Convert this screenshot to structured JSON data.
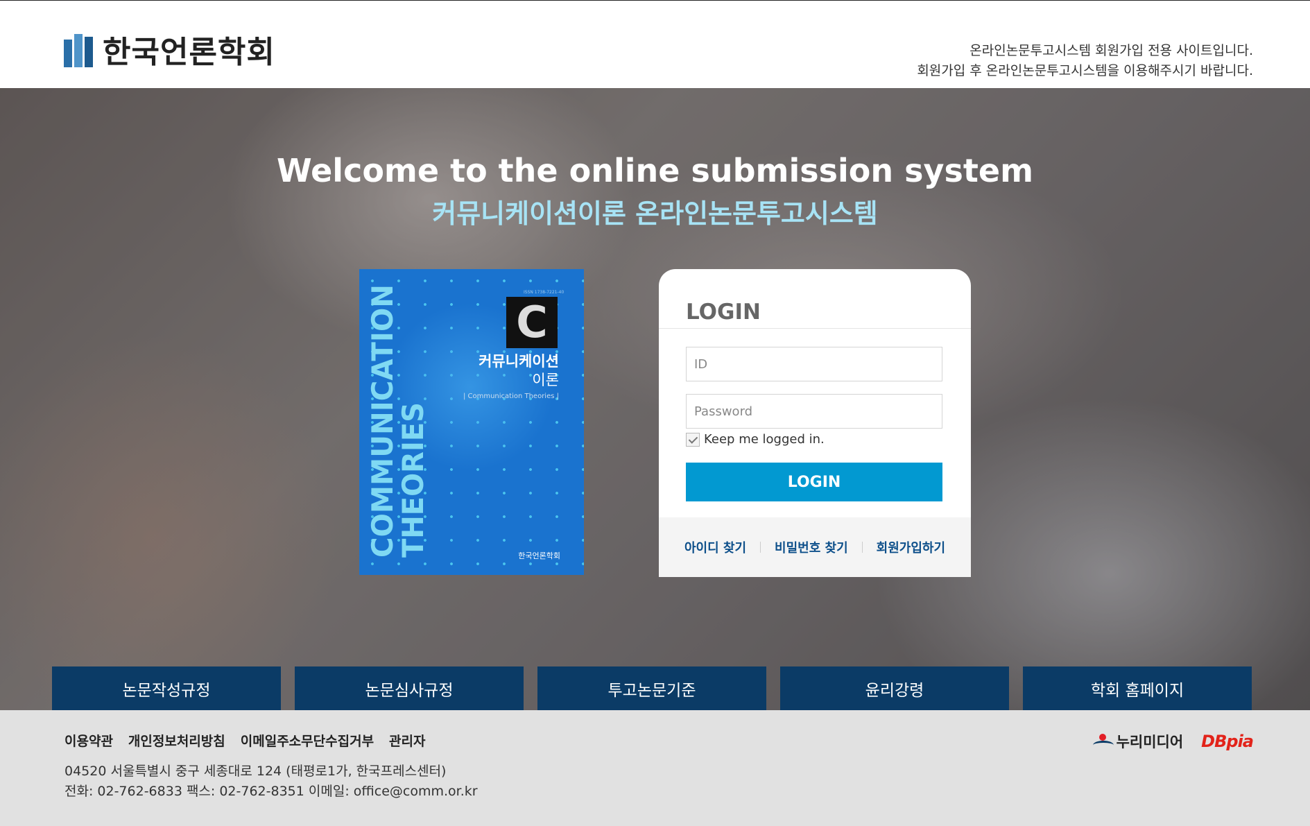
{
  "header": {
    "logo_text": "한국언론학회",
    "notice_line1": "온라인논문투고시스템 회원가입 전용 사이트입니다.",
    "notice_line2": "회원가입 후 온라인논문투고시스템을 이용해주시기 바랍니다."
  },
  "hero": {
    "title": "Welcome to the online submission system",
    "subtitle": "커뮤니케이션이론 온라인논문투고시스템"
  },
  "cover": {
    "vertical_title_line1": "COMMUNICATION",
    "vertical_title_line2": "THEORIES",
    "badge_letter": "C",
    "title_ko_line1": "커뮤니케이션",
    "title_ko_line2": "이론",
    "title_en": "| Communication Theories |",
    "publisher": "한국언론학회",
    "issn": "ISSN 1738-7221-40"
  },
  "login": {
    "heading": "LOGIN",
    "id_placeholder": "ID",
    "password_placeholder": "Password",
    "keep_label": "Keep me logged in.",
    "keep_checked": true,
    "button_label": "LOGIN",
    "links": [
      "아이디 찾기",
      "비밀번호 찾기",
      "회원가입하기"
    ]
  },
  "nav": {
    "items": [
      "논문작성규정",
      "논문심사규정",
      "투고논문기준",
      "윤리강령",
      "학회 홈페이지"
    ]
  },
  "footer": {
    "links": [
      "이용약관",
      "개인정보처리방침",
      "이메일주소무단수집거부",
      "관리자"
    ],
    "address": "04520 서울특별시 중구 세종대로 124 (태평로1가, 한국프레스센터)",
    "contact": "전화: 02-762-6833 팩스: 02-762-8351 이메일: office@comm.or.kr",
    "partner1": "누리미디어",
    "partner2": "DBpia"
  },
  "colors": {
    "nav_bg": "#0b3b66",
    "login_button": "#0299d1",
    "subtitle": "#a7e3f5",
    "cover_bg": "#1a73cf"
  }
}
